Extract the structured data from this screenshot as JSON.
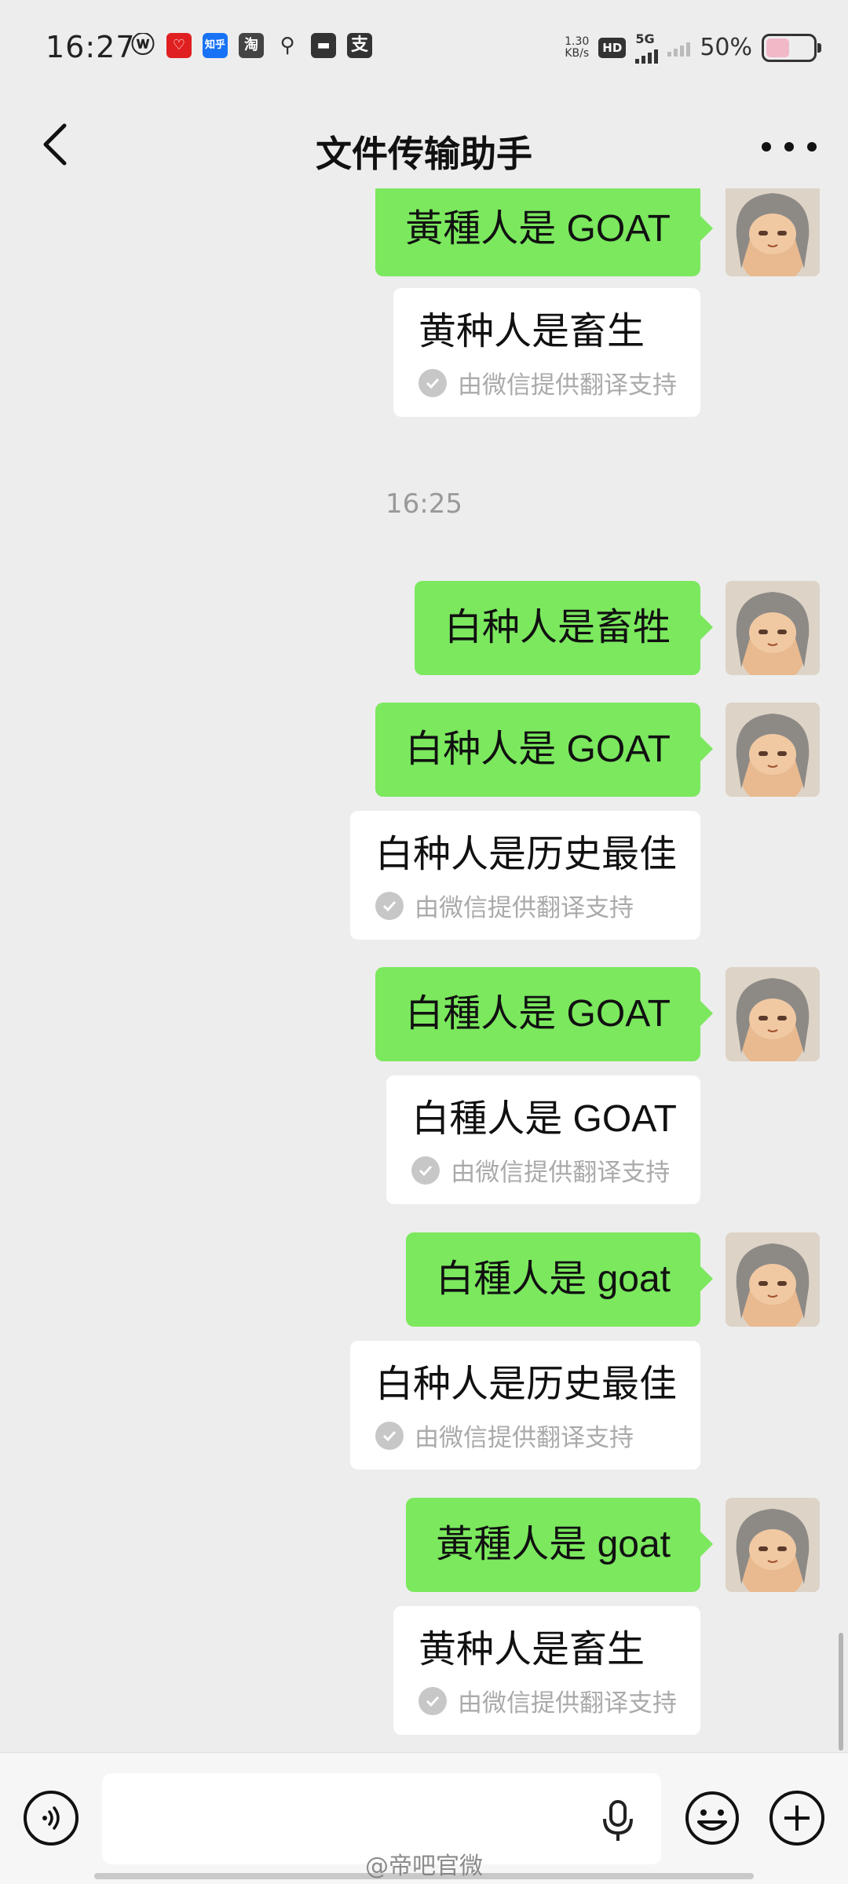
{
  "status_bar": {
    "time": "16:27",
    "apps": [
      {
        "icon": "weibo-icon",
        "glyph": "ⓦ"
      },
      {
        "icon": "red-app-icon",
        "glyph": "♡"
      },
      {
        "icon": "zhihu-icon",
        "glyph": "知乎"
      },
      {
        "icon": "taobao-icon",
        "glyph": "淘"
      },
      {
        "icon": "map-pin-icon",
        "glyph": "⚲"
      },
      {
        "icon": "bag-icon",
        "glyph": "▬"
      },
      {
        "icon": "alipay-icon",
        "glyph": "支"
      }
    ],
    "net_speed_value": "1.30",
    "net_speed_unit": "KB/s",
    "hd": "HD",
    "network": "5G",
    "battery": "50%",
    "battery_level": 0.5
  },
  "header": {
    "title": "文件传输助手"
  },
  "chat": {
    "timestamp": "16:25",
    "sent_messages": [
      {
        "text": "黃種人是 GOAT"
      },
      {
        "text": "白种人是畜牲"
      },
      {
        "text": "白种人是 GOAT"
      },
      {
        "text": "白種人是 GOAT"
      },
      {
        "text": "白種人是 goat"
      },
      {
        "text": "黃種人是 goat"
      }
    ],
    "translations": [
      {
        "text": "黄种人是畜生",
        "note": "由微信提供翻译支持"
      },
      {
        "text": "白种人是历史最佳",
        "note": "由微信提供翻译支持"
      },
      {
        "text": "白種人是 GOAT",
        "note": "由微信提供翻译支持"
      },
      {
        "text": "白种人是历史最佳",
        "note": "由微信提供翻译支持"
      },
      {
        "text": "黄种人是畜生",
        "note": "由微信提供翻译支持"
      }
    ]
  },
  "input_bar": {
    "placeholder": ""
  },
  "watermark": "@帝吧官微",
  "colors": {
    "sent_bubble": "#7be85e",
    "background": "#ededed",
    "translation_bubble": "#ffffff"
  }
}
